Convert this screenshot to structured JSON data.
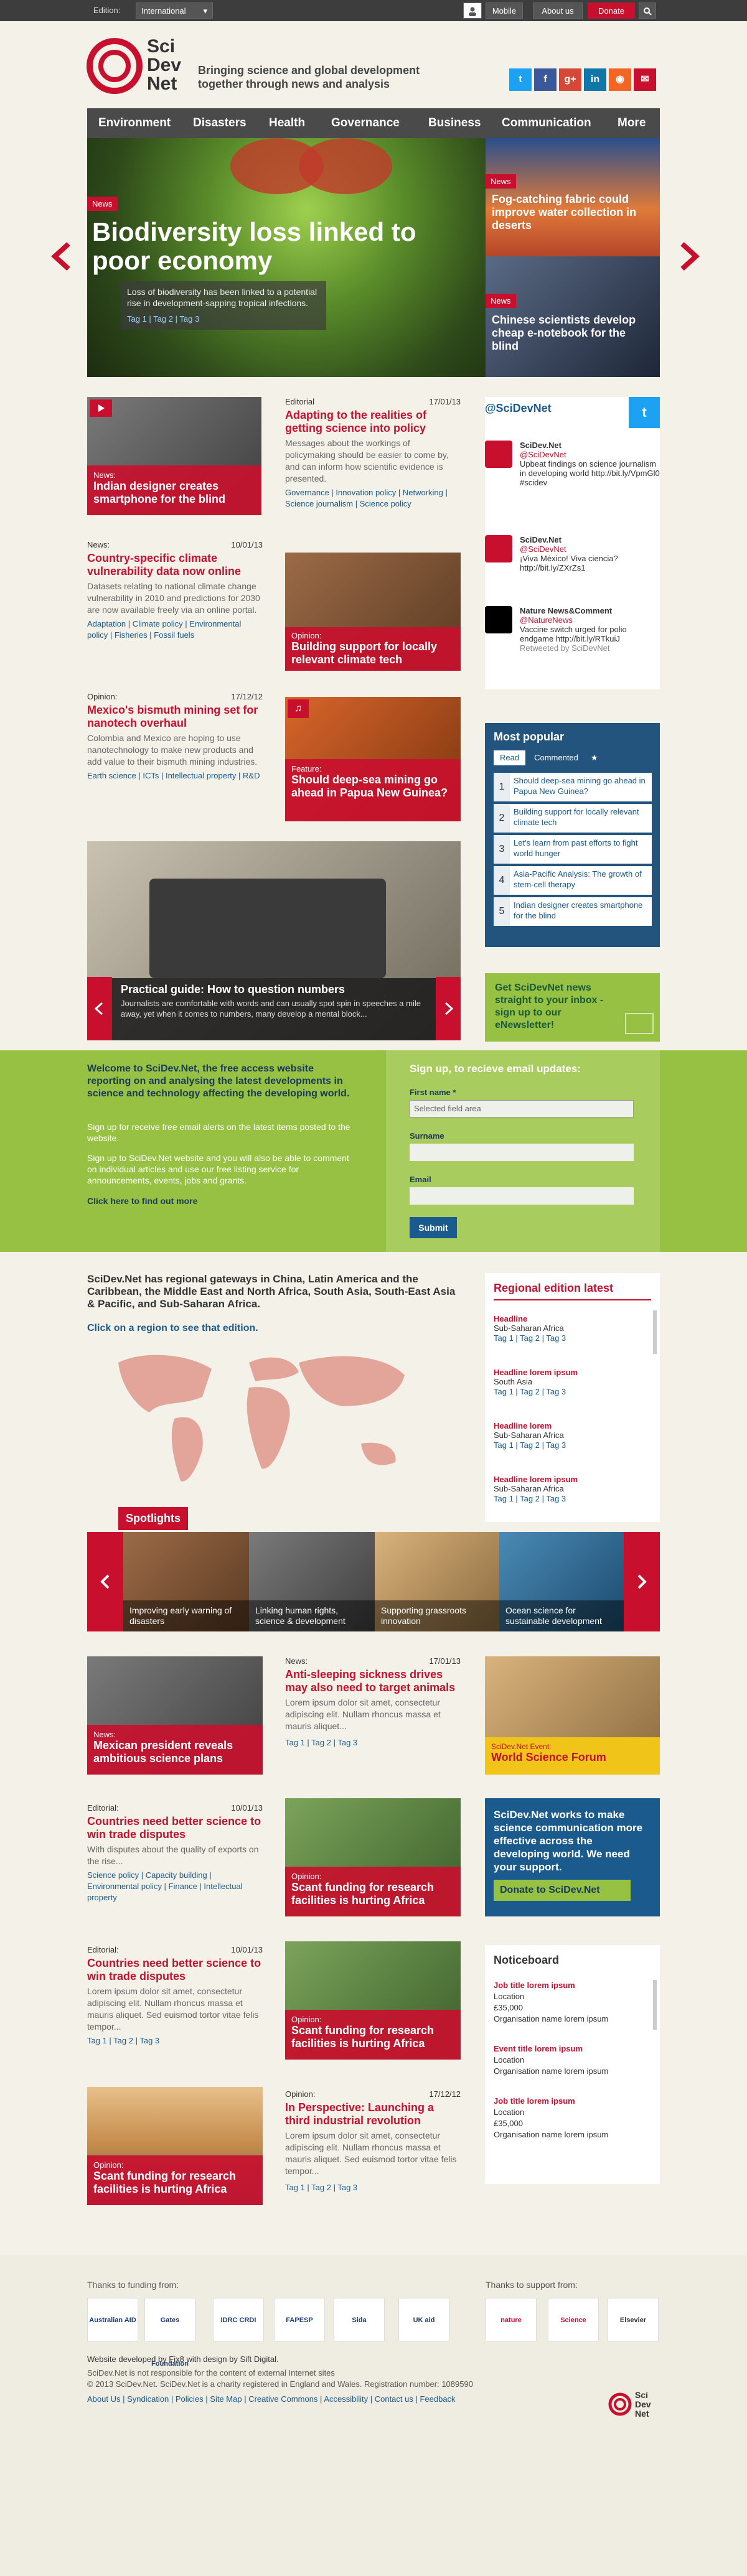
{
  "topbar": {
    "edition_label": "Edition:",
    "edition_value": "International",
    "mobile": "Mobile",
    "about": "About us",
    "donate": "Donate"
  },
  "brand": {
    "logo_line1": "Sci",
    "logo_line2": "Dev",
    "logo_line3": "Net",
    "tagline": "Bringing science and global development together through news and analysis"
  },
  "nav": [
    "Environment",
    "Disasters",
    "Health",
    "Governance",
    "Business",
    "Communication",
    "More"
  ],
  "hero": {
    "badge": "News",
    "title": "Biodiversity loss linked to poor economy",
    "summary": "Loss of biodiversity has been linked to a potential rise in development-sapping tropical infections.",
    "tags": [
      "Tag 1",
      "Tag 2",
      "Tag 3"
    ],
    "side": [
      {
        "badge": "News",
        "title": "Fog-catching fabric could improve water collection in deserts"
      },
      {
        "badge": "News",
        "title": "Chinese scientists develop cheap e-notebook for the blind"
      }
    ]
  },
  "grid": {
    "card1": {
      "kind": "News:",
      "title": "Indian designer creates smartphone for the blind"
    },
    "editorial1": {
      "kind": "Editorial",
      "date": "17/01/13",
      "title": "Adapting to the realities of getting science into policy",
      "body": "Messages about the workings of policymaking should be easier to come by, and can inform how scientific evidence is presented.",
      "tags": "Governance | Innovation policy | Networking | Science journalism | Science policy"
    },
    "news2": {
      "kind": "News:",
      "date": "10/01/13",
      "title": "Country-specific climate vulnerability data now online",
      "body": "Datasets relating to national climate change vulnerability in 2010 and predictions for 2030 are now available freely via an online portal.",
      "tags": "Adaptation | Climate policy | Environmental policy | Fisheries | Fossil fuels"
    },
    "card2": {
      "kind": "Opinion:",
      "title": "Building support for locally relevant climate tech"
    },
    "opinion3": {
      "kind": "Opinion:",
      "date": "17/12/12",
      "title": "Mexico's bismuth mining set for nanotech overhaul",
      "body": "Colombia and Mexico are hoping to use nanotechnology to make new products and add value to their bismuth mining industries.",
      "tags": "Earth science | ICTs | Intellectual property | R&D"
    },
    "card3": {
      "kind": "Feature:",
      "title": "Should deep-sea mining go ahead in Papua New Guinea?"
    },
    "guide": {
      "title": "Practical guide: How to question numbers",
      "body": "Journalists are comfortable with words and can usually spot spin in speeches a mile away, yet when it comes to numbers, many develop a mental block..."
    }
  },
  "twitter": {
    "handle": "@SciDevNet",
    "items": [
      {
        "name": "SciDev.Net",
        "at": "@SciDevNet",
        "text": "Upbeat findings on science journalism in developing world http://bit.ly/VpmGl0 #scidev"
      },
      {
        "name": "SciDev.Net",
        "at": "@SciDevNet",
        "text": "¡Viva México! Viva ciencia? http://bit.ly/ZXrZs1"
      },
      {
        "name": "Nature News&Comment",
        "at": "@NatureNews",
        "text": "Vaccine switch urged for polio endgame http://bit.ly/RTkuiJ",
        "rt": "Retweeted by SciDevNet"
      }
    ]
  },
  "popular": {
    "title": "Most popular",
    "tabs": [
      "Read",
      "Commented",
      "★"
    ],
    "items": [
      "Should deep-sea mining go ahead in Papua New Guinea?",
      "Building support for locally relevant climate tech",
      "Let's learn from past efforts to fight world hunger",
      "Asia-Pacific Analysis: The growth of stem-cell therapy",
      "Indian designer creates smartphone for the blind"
    ]
  },
  "newsletter": {
    "text": "Get SciDevNet news straight to your inbox - sign up to our eNewsletter!"
  },
  "welcome": {
    "title": "Welcome to SciDev.Net, the free access website reporting on and analysing the latest developments in science and technology affecting the developing world.",
    "p1": "Sign up for receive free email alerts on the latest items posted to the website.",
    "p2": "Sign up to SciDev.Net website and you will also be able to comment on individual articles and use our free listing service for announcements, events, jobs and grants.",
    "link": "Click here to find out more",
    "form_title": "Sign up, to recieve email updates:",
    "first": "First name *",
    "first_val": "Selected field area",
    "surname": "Surname",
    "email": "Email",
    "submit": "Submit"
  },
  "regions": {
    "title": "SciDev.Net has regional gateways in China, Latin America and the Caribbean, the Middle East and North Africa, South Asia, South-East Asia & Pacific, and Sub-Saharan Africa.",
    "link": "Click on a region to see that edition.",
    "latest_title": "Regional edition latest",
    "latest": [
      {
        "h": "Headline",
        "r": "Sub-Saharan Africa"
      },
      {
        "h": "Headline lorem ipsum",
        "r": "South Asia"
      },
      {
        "h": "Headline lorem",
        "r": "Sub-Saharan Africa"
      },
      {
        "h": "Headline lorem ipsum",
        "r": "Sub-Saharan Africa"
      }
    ],
    "tags": "Tag 1 | Tag 2 | Tag 3"
  },
  "spotlights": {
    "title": "Spotlights",
    "items": [
      "Improving early warning of disasters",
      "Linking human rights, science & development",
      "Supporting grassroots innovation",
      "Ocean science for sustainable development"
    ]
  },
  "lower": {
    "c1": {
      "kind": "News:",
      "title": "Mexican president reveals ambitious science plans"
    },
    "n1": {
      "kind": "News:",
      "date": "17/01/13",
      "title": "Anti-sleeping sickness drives may also need to target animals",
      "body": "Lorem ipsum dolor sit amet, consectetur adipiscing elit. Nullam rhoncus massa et mauris aliquet..."
    },
    "ev": {
      "kind": "SciDev.Net Event:",
      "title": "World Science Forum"
    },
    "e1": {
      "kind": "Editorial:",
      "date": "10/01/13",
      "title": "Countries need better science to win trade disputes",
      "body": "With disputes about the quality of exports on the rise...",
      "tags": "Science policy | Capacity building | Environmental policy | Finance | Intellectual property"
    },
    "c2": {
      "kind": "Opinion:",
      "title": "Scant funding for research facilities is hurting Africa"
    },
    "donate": {
      "text": "SciDev.Net works to make science communication more effective across the developing world. We need your support.",
      "btn": "Donate to SciDev.Net"
    },
    "e2": {
      "kind": "Editorial:",
      "date": "10/01/13",
      "title": "Countries need better science to win trade disputes",
      "body": "Lorem ipsum dolor sit amet, consectetur adipiscing elit. Nullam rhoncus massa et mauris aliquet. Sed euismod tortor vitae felis tempor..."
    },
    "c3": {
      "kind": "Opinion:",
      "title": "Scant funding for research facilities is hurting Africa"
    },
    "c4": {
      "kind": "Opinion:",
      "title": "Scant funding for research facilities is hurting Africa"
    },
    "o2": {
      "kind": "Opinion:",
      "date": "17/12/12",
      "title": "In Perspective: Launching a third industrial revolution",
      "body": "Lorem ipsum dolor sit amet, consectetur adipiscing elit. Nullam rhoncus massa et mauris aliquet. Sed euismod tortor vitae felis tempor..."
    },
    "tags": "Tag 1 | Tag 2 | Tag 3"
  },
  "noticeboard": {
    "title": "Noticeboard",
    "items": [
      {
        "h": "Job title lorem ipsum",
        "l": "Location",
        "p": "£35,000",
        "o": "Organisation name lorem ipsum"
      },
      {
        "h": "Event title lorem ipsum",
        "l": "Location",
        "p": "Organisation name lorem ipsum",
        "o": ""
      },
      {
        "h": "Job title lorem ipsum",
        "l": "Location",
        "p": "£35,000",
        "o": "Organisation name lorem ipsum"
      }
    ]
  },
  "footer": {
    "funding": "Thanks to funding from:",
    "support": "Thanks to support from:",
    "funders": [
      "Australian AID",
      "Gates Foundation",
      "IDRC CRDI",
      "FAPESP",
      "Sida",
      "UK aid"
    ],
    "supporters": [
      "nature",
      "Science",
      "Elsevier"
    ],
    "line1": "Website developed by Fix8 with design by Sift Digital.",
    "line2": "SciDev.Net is not responsible for the content of external Internet sites",
    "line3": "© 2013 SciDev.Net. SciDev.Net is a charity registered in England and Wales. Registration number: 1089590",
    "links": "About Us | Syndication | Policies | Site Map | Creative Commons | Accessibility | Contact us | Feedback"
  }
}
